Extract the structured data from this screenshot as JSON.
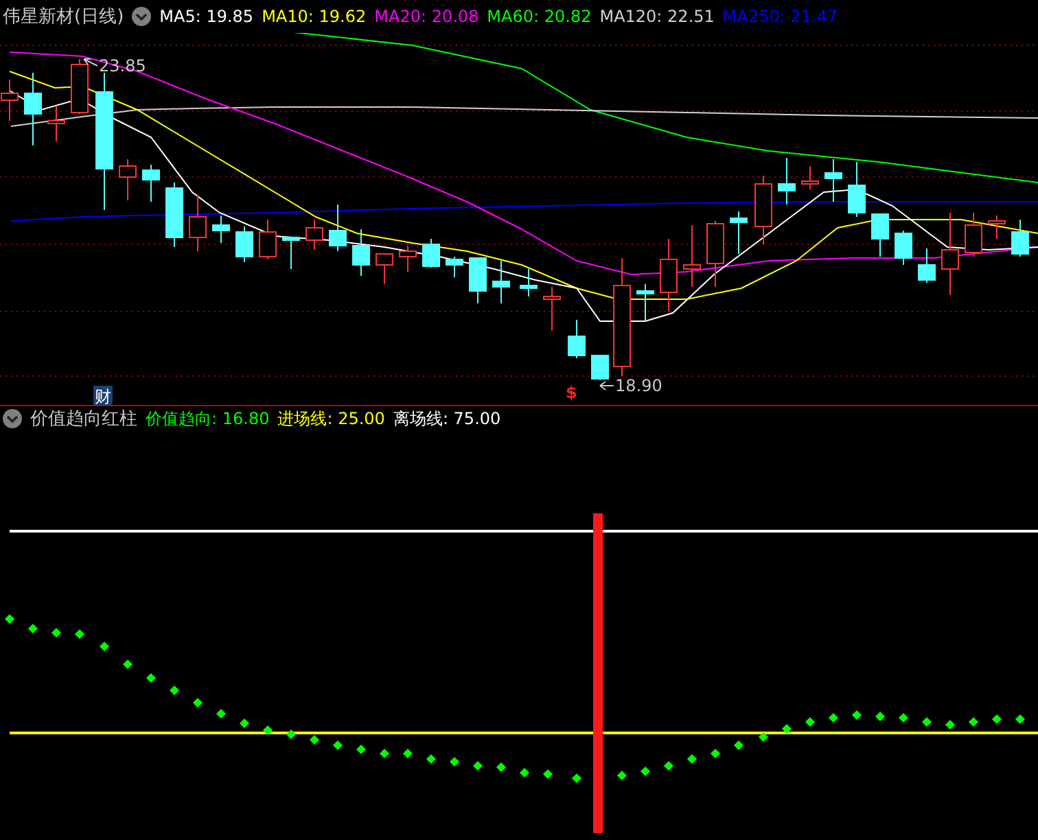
{
  "header": {
    "title": "伟星新材(日线)",
    "indicators": [
      {
        "label": "MA5: 19.85",
        "color": "#ffffff"
      },
      {
        "label": "MA10: 19.62",
        "color": "#ffff00"
      },
      {
        "label": "MA20: 20.08",
        "color": "#ff00ff"
      },
      {
        "label": "MA60: 20.82",
        "color": "#00ff00"
      },
      {
        "label": "MA120: 22.51",
        "color": "#d0d0d0"
      },
      {
        "label": "MA250: 21.47",
        "color": "#0000ff"
      }
    ]
  },
  "price_chart": {
    "high_label": "23.85",
    "low_label": "18.90",
    "finance_mark": "财",
    "signal_mark": "$"
  },
  "indicator_panel": {
    "title": "价值趋向红柱",
    "values": [
      {
        "label": "价值趋向: 16.80",
        "color": "#00ff00"
      },
      {
        "label": "进场线: 25.00",
        "color": "#ffff00"
      },
      {
        "label": "离场线: 75.00",
        "color": "#ffffff"
      }
    ]
  }
}
